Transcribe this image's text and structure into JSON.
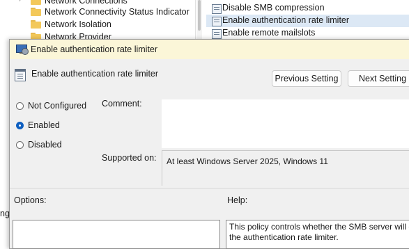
{
  "tree": {
    "items": [
      {
        "label": "Network Connections"
      },
      {
        "label": "Network Connectivity Status Indicator"
      },
      {
        "label": "Network Isolation"
      },
      {
        "label": "Network Provider"
      }
    ]
  },
  "policies": {
    "items": [
      {
        "label": "Disable SMB compression"
      },
      {
        "label": "Enable authentication rate limiter"
      },
      {
        "label": "Enable remote mailslots"
      }
    ]
  },
  "dialog": {
    "title": "Enable authentication rate limiter",
    "setting_name": "Enable authentication rate limiter",
    "prev_button": "Previous Setting",
    "next_button": "Next Setting",
    "radios": {
      "not_configured": "Not Configured",
      "enabled": "Enabled",
      "disabled": "Disabled",
      "selected": "Enabled"
    },
    "comment_label": "Comment:",
    "comment_value": "",
    "supported_label": "Supported on:",
    "supported_value": "At least Windows Server 2025, Windows 11",
    "options_label": "Options:",
    "help_label": "Help:",
    "help_text": "This policy controls whether the SMB server will enable the authentication rate limiter.",
    "edge_fragment": "ng"
  },
  "colors": {
    "title_bar": "#fbf6d8",
    "selected_row": "#dce8f5",
    "radio_accent": "#0f5fc0"
  }
}
